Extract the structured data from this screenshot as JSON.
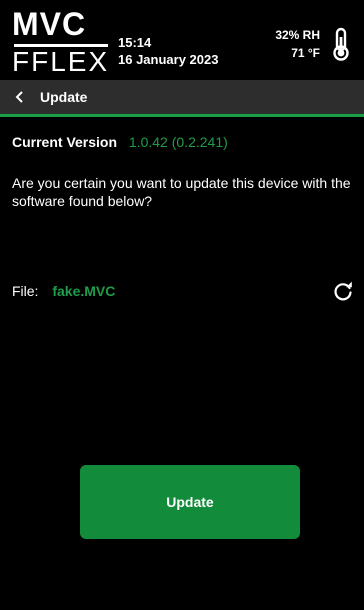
{
  "status": {
    "logo_top": "MVC",
    "logo_bottom": "FFLEX",
    "time": "15:14",
    "date": "16 January 2023",
    "humidity": "32% RH",
    "temperature": "71 °F",
    "thermo_icon": "thermometer-icon"
  },
  "nav": {
    "back_icon": "chevron-left-icon",
    "title": "Update"
  },
  "version": {
    "label": "Current Version",
    "value": "1.0.42 (0.2.241)"
  },
  "message": "Are you certain you want to update this device with the software found below?",
  "file": {
    "label": "File:",
    "value": "fake.MVC",
    "refresh_icon": "refresh-icon"
  },
  "actions": {
    "update_label": "Update"
  },
  "colors": {
    "accent": "#1b9e45",
    "button": "#128b3a",
    "nav_bg": "#2d2d2d",
    "background": "#000000"
  }
}
